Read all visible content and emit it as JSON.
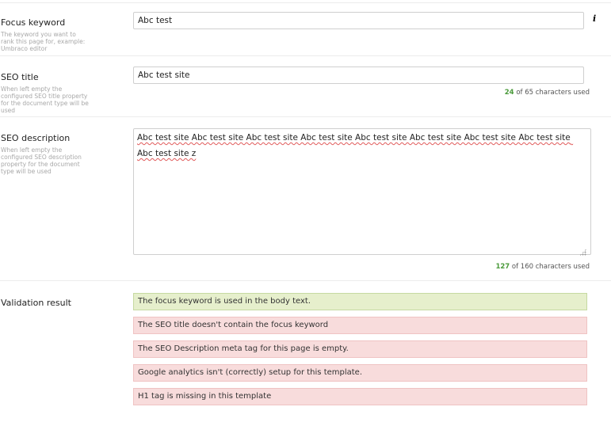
{
  "focus_keyword": {
    "label": "Focus keyword",
    "description": "The keyword you want to rank this page for, example: Umbraco editor",
    "value": "Abc test",
    "info_icon": "info-icon"
  },
  "seo_title": {
    "label": "SEO title",
    "description": "When left empty the configured SEO title property for the document type will be used",
    "value": "Abc test site",
    "count": "24",
    "count_suffix": "of 65 characters used"
  },
  "seo_description": {
    "label": "SEO description",
    "description": "When left empty the configured SEO description property for the document type will be used",
    "value": "Abc test site Abc test site Abc test site Abc test site Abc test site Abc test site Abc test site Abc test site Abc test site z",
    "count": "127",
    "count_suffix": "of 160 characters used"
  },
  "validation": {
    "label": "Validation result",
    "results": [
      {
        "text": "The focus keyword is used in the body text.",
        "status": "success"
      },
      {
        "text": "The SEO title doesn't contain the focus keyword",
        "status": "error"
      },
      {
        "text": "The SEO Description meta tag for this page is empty.",
        "status": "error"
      },
      {
        "text": "Google analytics isn't (correctly) setup for this template.",
        "status": "error"
      },
      {
        "text": "H1 tag is missing in this template",
        "status": "error"
      }
    ]
  },
  "colors": {
    "success_bg": "#e6efcc",
    "error_bg": "#f8dcdc",
    "counter_number": "#4a9a3a"
  }
}
